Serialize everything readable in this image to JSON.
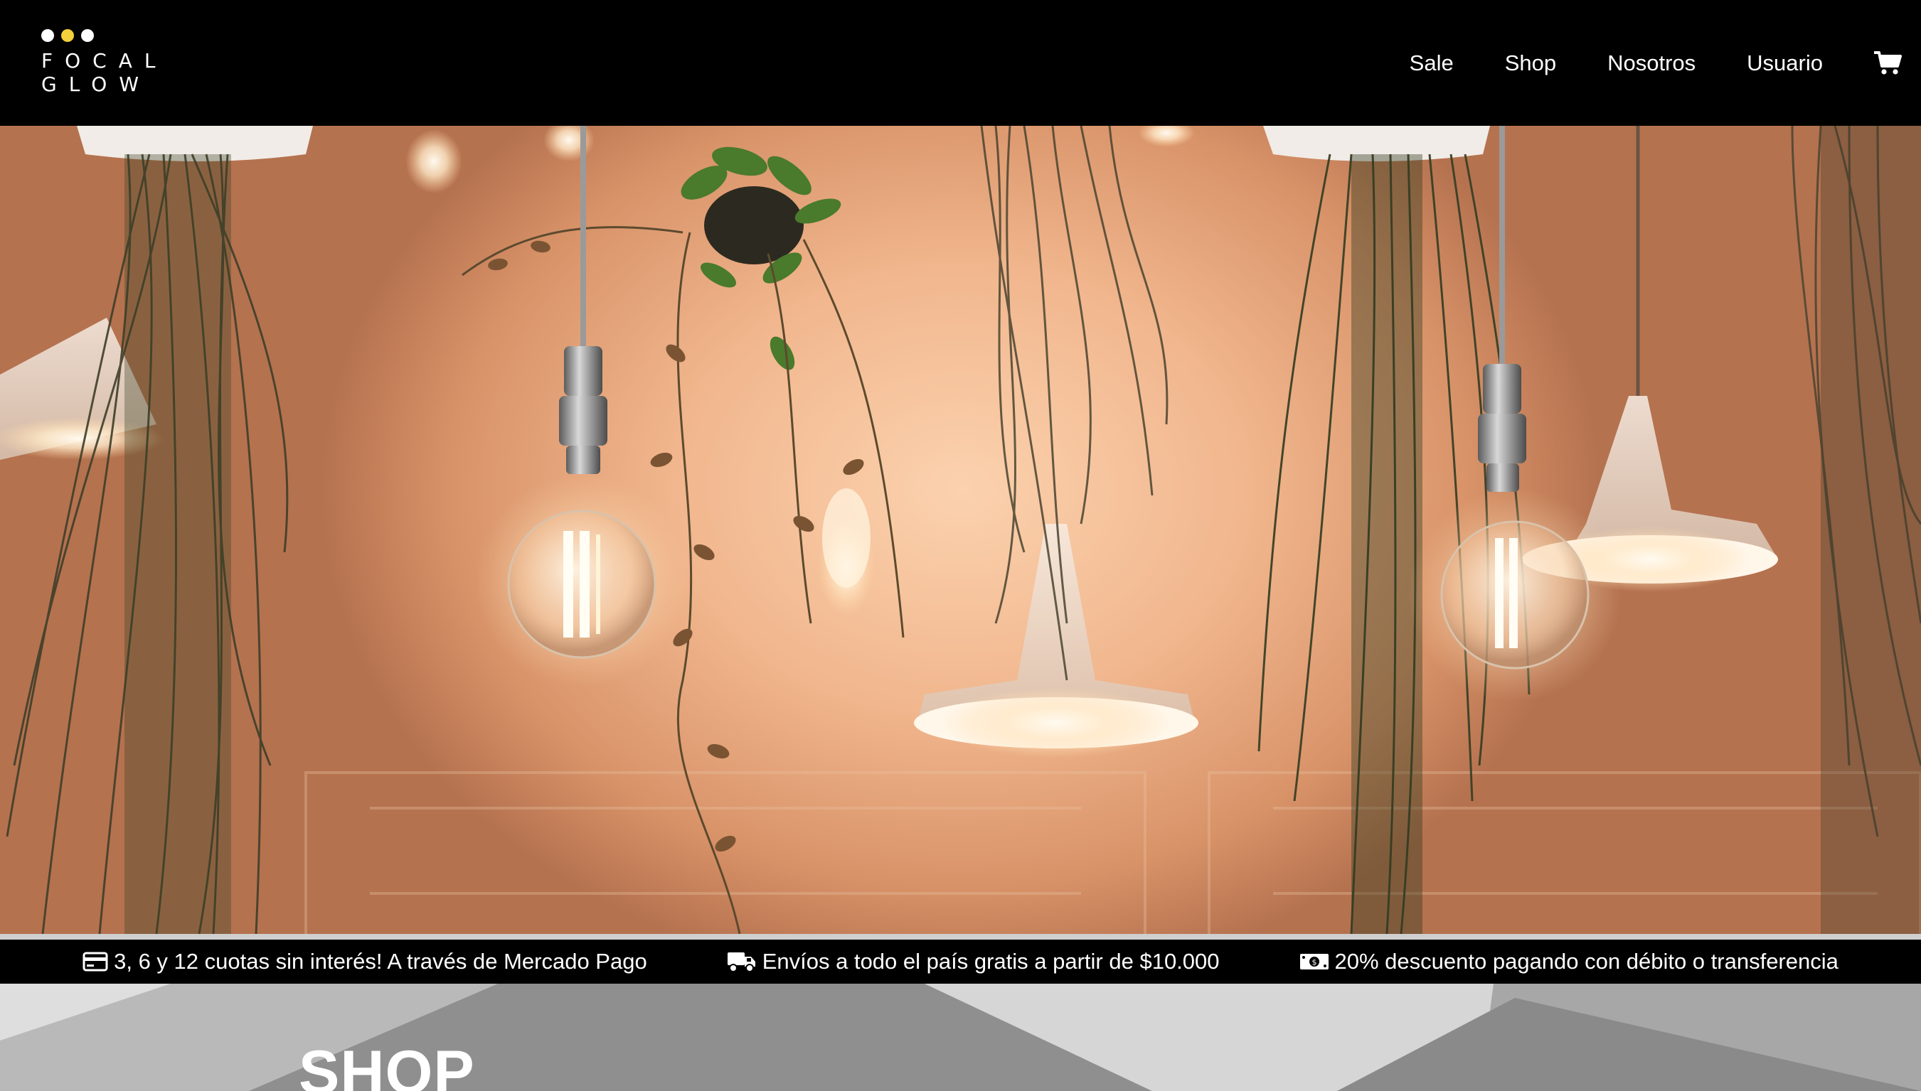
{
  "brand": {
    "line1": "FOCAL",
    "line2": "GLOW",
    "dot_colors": [
      "#ffffff",
      "#f2d03b",
      "#ffffff"
    ]
  },
  "nav": {
    "items": [
      {
        "label": "Sale"
      },
      {
        "label": "Shop"
      },
      {
        "label": "Nosotros"
      },
      {
        "label": "Usuario"
      }
    ],
    "cart_icon": "shopping-cart-icon"
  },
  "hero": {
    "image": "hanging-lightbulbs-and-plants",
    "colors": {
      "wall": "#f1b68d",
      "plant": "#3e4a2a"
    }
  },
  "infobar": {
    "items": [
      {
        "icon": "credit-card-icon",
        "text": "3, 6 y 12 cuotas sin interés! A través de Mercado Pago"
      },
      {
        "icon": "truck-icon",
        "text": "Envíos a todo el país gratis a partir de $10.000"
      },
      {
        "icon": "money-bill-icon",
        "text": "20% descuento pagando con débito o transferencia"
      }
    ]
  },
  "shop": {
    "title": "SHOP"
  }
}
